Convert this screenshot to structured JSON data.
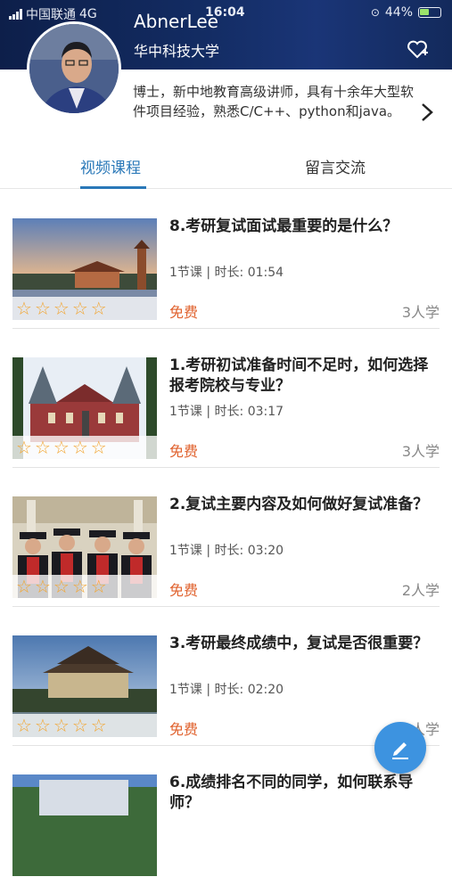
{
  "status_bar": {
    "carrier": "中国联通",
    "network": "4G",
    "time": "16:04",
    "battery": "44%"
  },
  "header": {
    "name": "AbnerLee",
    "school": "华中科技大学"
  },
  "intro": "博士，新中地教育高级讲师，具有十余年大型软件项目经验，熟悉C/C++、python和java。",
  "tabs": [
    {
      "label": "视频课程",
      "active": true
    },
    {
      "label": "留言交流",
      "active": false
    }
  ],
  "courses": [
    {
      "title": "8.考研复试面试最重要的是什么？",
      "meta": "1节课 | 时长: 01:54",
      "price": "免费",
      "learners": "3人学",
      "thumb": "pagoda"
    },
    {
      "title": "1.考研初试准备时间不足时，如何选择报考院校与专业？",
      "meta": "1节课 | 时长: 03:17",
      "price": "免费",
      "learners": "3人学",
      "thumb": "red-building"
    },
    {
      "title": "2.复试主要内容及如何做好复试准备？",
      "meta": "1节课 | 时长: 03:20",
      "price": "免费",
      "learners": "2人学",
      "thumb": "graduates"
    },
    {
      "title": "3.考研最终成绩中，复试是否很重要？",
      "meta": "1节课 | 时长: 02:20",
      "price": "免费",
      "learners": "人学",
      "thumb": "palace"
    },
    {
      "title": "6.成绩排名不同的同学，如何联系导师？",
      "meta": "",
      "price": "",
      "learners": "",
      "thumb": "campus"
    }
  ],
  "rating_stars": 5,
  "colors": {
    "header_bg": "#132c63",
    "accent": "#2a78b8",
    "price": "#e0622e",
    "star": "#f2a530",
    "fab": "#3d93e0"
  }
}
